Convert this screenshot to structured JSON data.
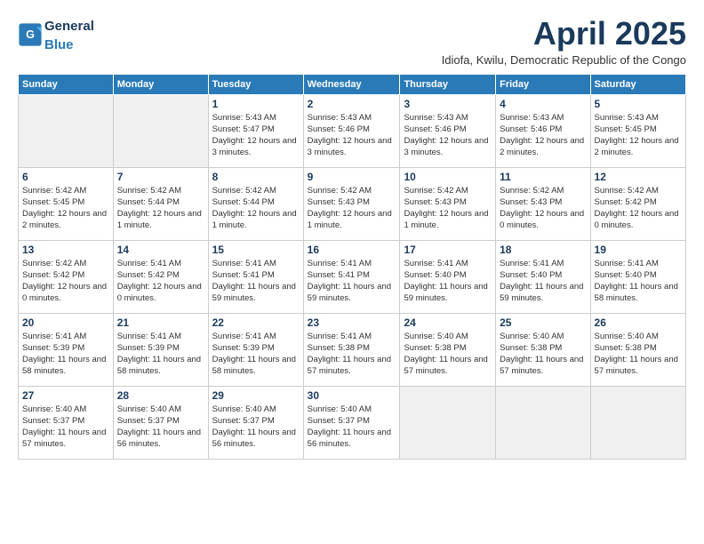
{
  "header": {
    "logo_general": "General",
    "logo_blue": "Blue",
    "month_title": "April 2025",
    "location": "Idiofa, Kwilu, Democratic Republic of the Congo"
  },
  "weekdays": [
    "Sunday",
    "Monday",
    "Tuesday",
    "Wednesday",
    "Thursday",
    "Friday",
    "Saturday"
  ],
  "weeks": [
    [
      {
        "day": "",
        "info": ""
      },
      {
        "day": "",
        "info": ""
      },
      {
        "day": "1",
        "info": "Sunrise: 5:43 AM\nSunset: 5:47 PM\nDaylight: 12 hours and 3 minutes."
      },
      {
        "day": "2",
        "info": "Sunrise: 5:43 AM\nSunset: 5:46 PM\nDaylight: 12 hours and 3 minutes."
      },
      {
        "day": "3",
        "info": "Sunrise: 5:43 AM\nSunset: 5:46 PM\nDaylight: 12 hours and 3 minutes."
      },
      {
        "day": "4",
        "info": "Sunrise: 5:43 AM\nSunset: 5:46 PM\nDaylight: 12 hours and 2 minutes."
      },
      {
        "day": "5",
        "info": "Sunrise: 5:43 AM\nSunset: 5:45 PM\nDaylight: 12 hours and 2 minutes."
      }
    ],
    [
      {
        "day": "6",
        "info": "Sunrise: 5:42 AM\nSunset: 5:45 PM\nDaylight: 12 hours and 2 minutes."
      },
      {
        "day": "7",
        "info": "Sunrise: 5:42 AM\nSunset: 5:44 PM\nDaylight: 12 hours and 1 minute."
      },
      {
        "day": "8",
        "info": "Sunrise: 5:42 AM\nSunset: 5:44 PM\nDaylight: 12 hours and 1 minute."
      },
      {
        "day": "9",
        "info": "Sunrise: 5:42 AM\nSunset: 5:43 PM\nDaylight: 12 hours and 1 minute."
      },
      {
        "day": "10",
        "info": "Sunrise: 5:42 AM\nSunset: 5:43 PM\nDaylight: 12 hours and 1 minute."
      },
      {
        "day": "11",
        "info": "Sunrise: 5:42 AM\nSunset: 5:43 PM\nDaylight: 12 hours and 0 minutes."
      },
      {
        "day": "12",
        "info": "Sunrise: 5:42 AM\nSunset: 5:42 PM\nDaylight: 12 hours and 0 minutes."
      }
    ],
    [
      {
        "day": "13",
        "info": "Sunrise: 5:42 AM\nSunset: 5:42 PM\nDaylight: 12 hours and 0 minutes."
      },
      {
        "day": "14",
        "info": "Sunrise: 5:41 AM\nSunset: 5:42 PM\nDaylight: 12 hours and 0 minutes."
      },
      {
        "day": "15",
        "info": "Sunrise: 5:41 AM\nSunset: 5:41 PM\nDaylight: 11 hours and 59 minutes."
      },
      {
        "day": "16",
        "info": "Sunrise: 5:41 AM\nSunset: 5:41 PM\nDaylight: 11 hours and 59 minutes."
      },
      {
        "day": "17",
        "info": "Sunrise: 5:41 AM\nSunset: 5:40 PM\nDaylight: 11 hours and 59 minutes."
      },
      {
        "day": "18",
        "info": "Sunrise: 5:41 AM\nSunset: 5:40 PM\nDaylight: 11 hours and 59 minutes."
      },
      {
        "day": "19",
        "info": "Sunrise: 5:41 AM\nSunset: 5:40 PM\nDaylight: 11 hours and 58 minutes."
      }
    ],
    [
      {
        "day": "20",
        "info": "Sunrise: 5:41 AM\nSunset: 5:39 PM\nDaylight: 11 hours and 58 minutes."
      },
      {
        "day": "21",
        "info": "Sunrise: 5:41 AM\nSunset: 5:39 PM\nDaylight: 11 hours and 58 minutes."
      },
      {
        "day": "22",
        "info": "Sunrise: 5:41 AM\nSunset: 5:39 PM\nDaylight: 11 hours and 58 minutes."
      },
      {
        "day": "23",
        "info": "Sunrise: 5:41 AM\nSunset: 5:38 PM\nDaylight: 11 hours and 57 minutes."
      },
      {
        "day": "24",
        "info": "Sunrise: 5:40 AM\nSunset: 5:38 PM\nDaylight: 11 hours and 57 minutes."
      },
      {
        "day": "25",
        "info": "Sunrise: 5:40 AM\nSunset: 5:38 PM\nDaylight: 11 hours and 57 minutes."
      },
      {
        "day": "26",
        "info": "Sunrise: 5:40 AM\nSunset: 5:38 PM\nDaylight: 11 hours and 57 minutes."
      }
    ],
    [
      {
        "day": "27",
        "info": "Sunrise: 5:40 AM\nSunset: 5:37 PM\nDaylight: 11 hours and 57 minutes."
      },
      {
        "day": "28",
        "info": "Sunrise: 5:40 AM\nSunset: 5:37 PM\nDaylight: 11 hours and 56 minutes."
      },
      {
        "day": "29",
        "info": "Sunrise: 5:40 AM\nSunset: 5:37 PM\nDaylight: 11 hours and 56 minutes."
      },
      {
        "day": "30",
        "info": "Sunrise: 5:40 AM\nSunset: 5:37 PM\nDaylight: 11 hours and 56 minutes."
      },
      {
        "day": "",
        "info": ""
      },
      {
        "day": "",
        "info": ""
      },
      {
        "day": "",
        "info": ""
      }
    ]
  ]
}
